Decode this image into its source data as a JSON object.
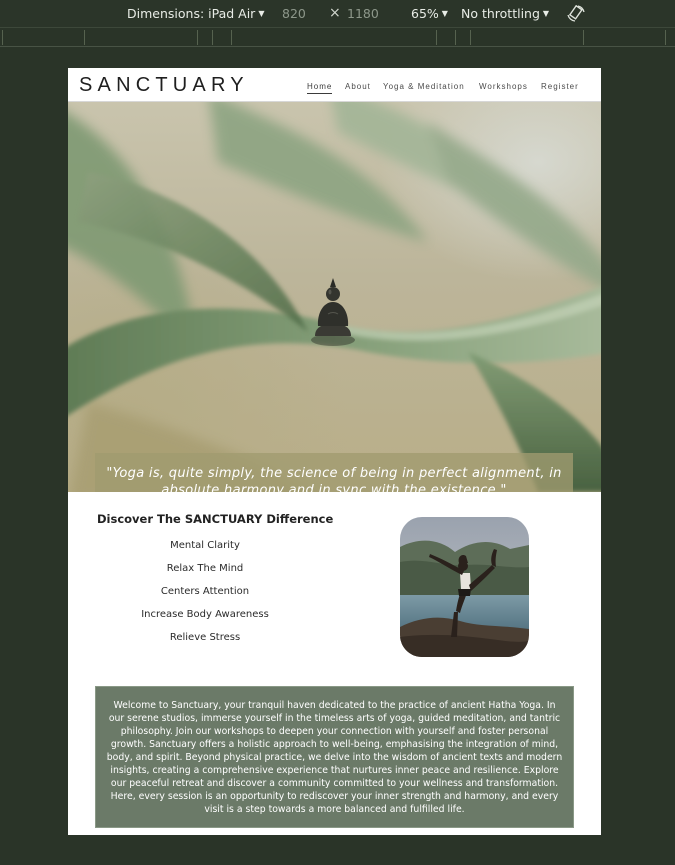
{
  "devtools": {
    "device_label": "Dimensions: iPad Air",
    "width": "820",
    "times": "×",
    "height": "1180",
    "zoom": "65%",
    "throttling": "No throttling",
    "rotate_icon": "rotate-icon"
  },
  "site": {
    "logo": "SANCTUARY",
    "nav": [
      {
        "label": "Home",
        "active": true
      },
      {
        "label": "About"
      },
      {
        "label": "Yoga & Meditation"
      },
      {
        "label": "Workshops"
      },
      {
        "label": "Register"
      }
    ],
    "hero_quote": "\"Yoga is, quite simply, the science of being in perfect alignment, in absolute harmony and in sync with the existence.\"",
    "difference_title": "Discover The SANCTUARY Difference",
    "benefits": [
      "Mental Clarity",
      "Relax The Mind",
      "Centers Attention",
      "Increase Body Awareness",
      "Relieve Stress"
    ],
    "welcome_text": "Welcome to Sanctuary, your tranquil haven dedicated to the practice of ancient Hatha Yoga. In our serene studios, immerse yourself in the timeless arts of yoga, guided meditation, and tantric philosophy. Join our workshops to deepen your connection with yourself and foster personal growth. Sanctuary offers a holistic approach to well-being, emphasising the integration of mind, body, and spirit. Beyond physical practice, we delve into the wisdom of ancient texts and modern insights, creating a comprehensive experience that nurtures inner peace and resilience. Explore our peaceful retreat and discover a community committed to your wellness and transformation. Here, every session is an opportunity to rediscover your inner strength and harmony, and every visit is a step towards a more balanced and fulfilled life."
  },
  "colors": {
    "devtools_bg": "#2a3428",
    "quote_overlay": "#a09b70",
    "welcome_bg": "#6b7a68"
  }
}
